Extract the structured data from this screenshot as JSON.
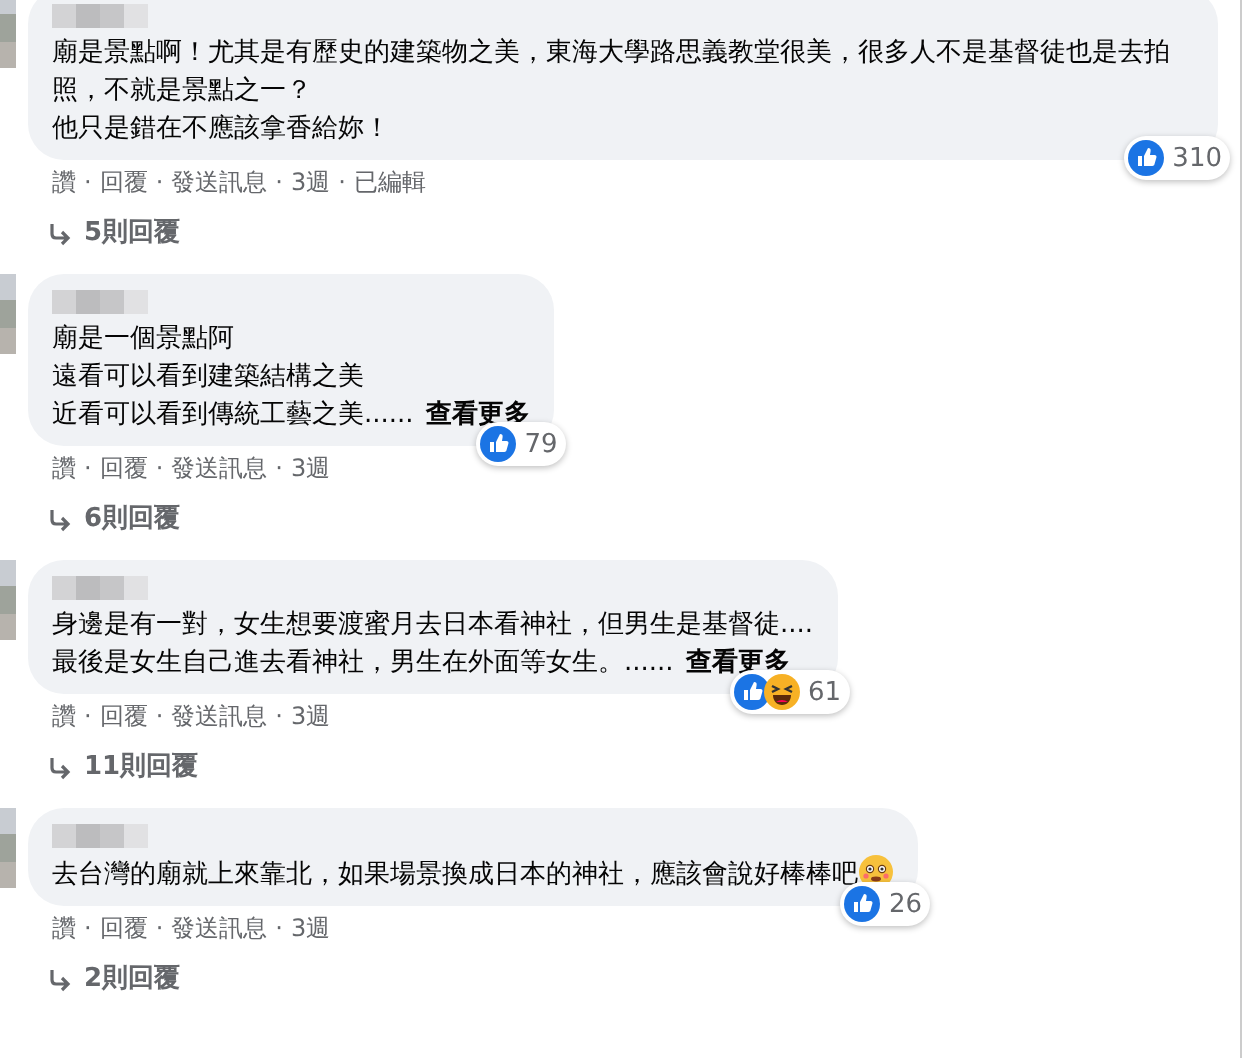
{
  "separator": "·",
  "comments": [
    {
      "lines": [
        "廟是景點啊！尤其是有歷史的建築物之美，東海大學路思義教堂很美，很多人不是基督徒也是去拍照，不就是景點之一？",
        "他只是錯在不應該拿香給妳！"
      ],
      "reactions": [
        {
          "kind": "like"
        }
      ],
      "count": "310",
      "actions": [
        "讚",
        "回覆",
        "發送訊息",
        "3週",
        "已編輯"
      ],
      "replies": "5則回覆"
    },
    {
      "lines": [
        "廟是一個景點阿",
        "遠看可以看到建築結構之美",
        "近看可以看到傳統工藝之美......"
      ],
      "see_more": "查看更多",
      "reactions": [
        {
          "kind": "like"
        }
      ],
      "count": "79",
      "actions": [
        "讚",
        "回覆",
        "發送訊息",
        "3週"
      ],
      "replies": "6則回覆"
    },
    {
      "lines": [
        "身邊是有一對，女生想要渡蜜月去日本看神社，但男生是基督徒....",
        "最後是女生自己進去看神社，男生在外面等女生。......"
      ],
      "see_more": "查看更多",
      "reactions": [
        {
          "kind": "like"
        },
        {
          "kind": "haha"
        }
      ],
      "count": "61",
      "actions": [
        "讚",
        "回覆",
        "發送訊息",
        "3週"
      ],
      "replies": "11則回覆"
    },
    {
      "lines": [
        "去台灣的廟就上來靠北，如果場景換成日本的神社，應該會說好棒棒吧"
      ],
      "end_emoji": {
        "kind": "flushed"
      },
      "reactions": [
        {
          "kind": "like"
        }
      ],
      "count": "26",
      "actions": [
        "讚",
        "回覆",
        "發送訊息",
        "3週"
      ],
      "replies": "2則回覆"
    }
  ]
}
